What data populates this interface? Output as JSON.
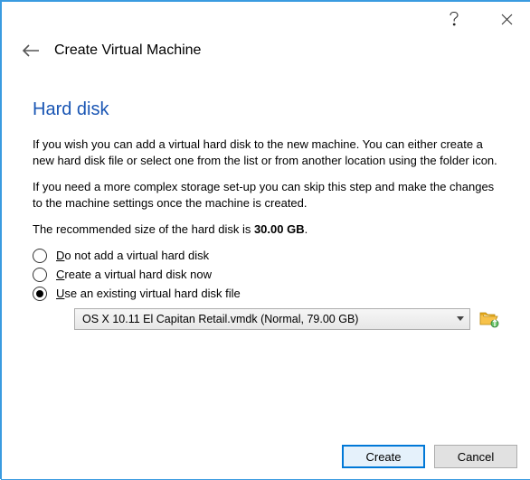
{
  "titlebar": {
    "help_tooltip": "Help",
    "close_tooltip": "Close"
  },
  "header": {
    "wizard_title": "Create Virtual Machine"
  },
  "section": {
    "heading": "Hard disk",
    "para1": "If you wish you can add a virtual hard disk to the new machine. You can either create a new hard disk file or select one from the list or from another location using the folder icon.",
    "para2": "If you need a more complex storage set-up you can skip this step and make the changes to the machine settings once the machine is created.",
    "para3_prefix": "The recommended size of the hard disk is ",
    "para3_bold": "30.00 GB",
    "para3_suffix": "."
  },
  "options": {
    "opt1_pre": "D",
    "opt1_rest": "o not add a virtual hard disk",
    "opt2_pre": "C",
    "opt2_rest": "reate a virtual hard disk now",
    "opt3_pre": "U",
    "opt3_rest": "se an existing virtual hard disk file",
    "selected_index": 2
  },
  "combo": {
    "selected_text": "OS X 10.11 El Capitan Retail.vmdk (Normal, 79.00 GB)"
  },
  "buttons": {
    "primary": "Create",
    "secondary": "Cancel"
  }
}
